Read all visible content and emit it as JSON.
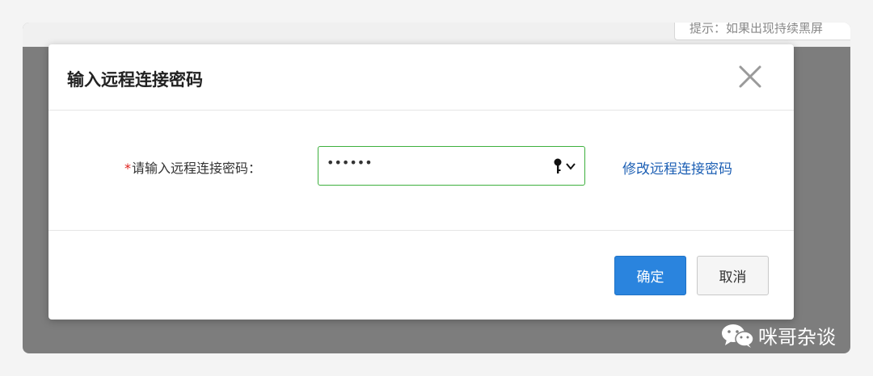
{
  "background": {
    "hint_text": "提示：如果出现持续黑屏"
  },
  "dialog": {
    "title": "输入远程连接密码",
    "field": {
      "required_mark": "*",
      "label": "请输入远程连接密码：",
      "value": "••••••"
    },
    "change_password_link": "修改远程连接密码",
    "confirm_label": "确定",
    "cancel_label": "取消"
  },
  "watermark": {
    "text": "咪哥杂谈"
  },
  "colors": {
    "accent": "#2a84de",
    "link": "#1c5fb4",
    "focus_border": "#3db03d",
    "required": "#e0201b"
  },
  "icons": [
    "close-icon",
    "key-icon",
    "chevron-down-icon",
    "wechat-icon"
  ]
}
